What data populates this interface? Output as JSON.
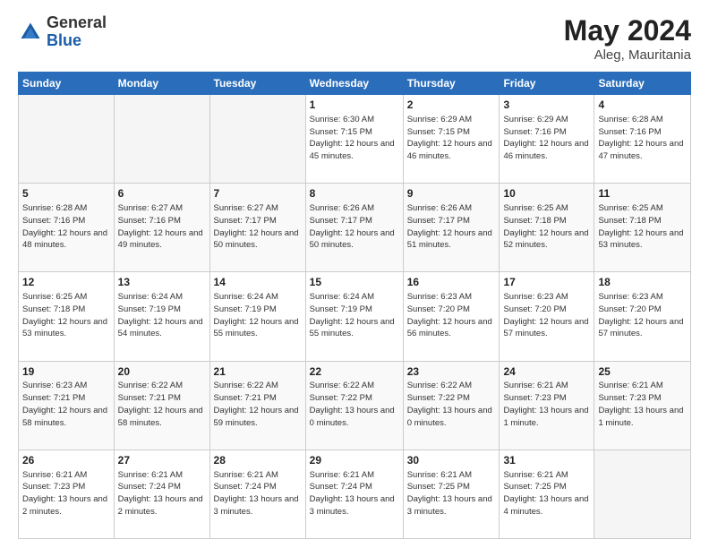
{
  "header": {
    "logo": {
      "line1": "General",
      "line2": "Blue"
    },
    "title": "May 2024",
    "location": "Aleg, Mauritania"
  },
  "weekdays": [
    "Sunday",
    "Monday",
    "Tuesday",
    "Wednesday",
    "Thursday",
    "Friday",
    "Saturday"
  ],
  "weeks": [
    [
      {
        "day": "",
        "info": ""
      },
      {
        "day": "",
        "info": ""
      },
      {
        "day": "",
        "info": ""
      },
      {
        "day": "1",
        "info": "Sunrise: 6:30 AM\nSunset: 7:15 PM\nDaylight: 12 hours\nand 45 minutes."
      },
      {
        "day": "2",
        "info": "Sunrise: 6:29 AM\nSunset: 7:15 PM\nDaylight: 12 hours\nand 46 minutes."
      },
      {
        "day": "3",
        "info": "Sunrise: 6:29 AM\nSunset: 7:16 PM\nDaylight: 12 hours\nand 46 minutes."
      },
      {
        "day": "4",
        "info": "Sunrise: 6:28 AM\nSunset: 7:16 PM\nDaylight: 12 hours\nand 47 minutes."
      }
    ],
    [
      {
        "day": "5",
        "info": "Sunrise: 6:28 AM\nSunset: 7:16 PM\nDaylight: 12 hours\nand 48 minutes."
      },
      {
        "day": "6",
        "info": "Sunrise: 6:27 AM\nSunset: 7:16 PM\nDaylight: 12 hours\nand 49 minutes."
      },
      {
        "day": "7",
        "info": "Sunrise: 6:27 AM\nSunset: 7:17 PM\nDaylight: 12 hours\nand 50 minutes."
      },
      {
        "day": "8",
        "info": "Sunrise: 6:26 AM\nSunset: 7:17 PM\nDaylight: 12 hours\nand 50 minutes."
      },
      {
        "day": "9",
        "info": "Sunrise: 6:26 AM\nSunset: 7:17 PM\nDaylight: 12 hours\nand 51 minutes."
      },
      {
        "day": "10",
        "info": "Sunrise: 6:25 AM\nSunset: 7:18 PM\nDaylight: 12 hours\nand 52 minutes."
      },
      {
        "day": "11",
        "info": "Sunrise: 6:25 AM\nSunset: 7:18 PM\nDaylight: 12 hours\nand 53 minutes."
      }
    ],
    [
      {
        "day": "12",
        "info": "Sunrise: 6:25 AM\nSunset: 7:18 PM\nDaylight: 12 hours\nand 53 minutes."
      },
      {
        "day": "13",
        "info": "Sunrise: 6:24 AM\nSunset: 7:19 PM\nDaylight: 12 hours\nand 54 minutes."
      },
      {
        "day": "14",
        "info": "Sunrise: 6:24 AM\nSunset: 7:19 PM\nDaylight: 12 hours\nand 55 minutes."
      },
      {
        "day": "15",
        "info": "Sunrise: 6:24 AM\nSunset: 7:19 PM\nDaylight: 12 hours\nand 55 minutes."
      },
      {
        "day": "16",
        "info": "Sunrise: 6:23 AM\nSunset: 7:20 PM\nDaylight: 12 hours\nand 56 minutes."
      },
      {
        "day": "17",
        "info": "Sunrise: 6:23 AM\nSunset: 7:20 PM\nDaylight: 12 hours\nand 57 minutes."
      },
      {
        "day": "18",
        "info": "Sunrise: 6:23 AM\nSunset: 7:20 PM\nDaylight: 12 hours\nand 57 minutes."
      }
    ],
    [
      {
        "day": "19",
        "info": "Sunrise: 6:23 AM\nSunset: 7:21 PM\nDaylight: 12 hours\nand 58 minutes."
      },
      {
        "day": "20",
        "info": "Sunrise: 6:22 AM\nSunset: 7:21 PM\nDaylight: 12 hours\nand 58 minutes."
      },
      {
        "day": "21",
        "info": "Sunrise: 6:22 AM\nSunset: 7:21 PM\nDaylight: 12 hours\nand 59 minutes."
      },
      {
        "day": "22",
        "info": "Sunrise: 6:22 AM\nSunset: 7:22 PM\nDaylight: 13 hours\nand 0 minutes."
      },
      {
        "day": "23",
        "info": "Sunrise: 6:22 AM\nSunset: 7:22 PM\nDaylight: 13 hours\nand 0 minutes."
      },
      {
        "day": "24",
        "info": "Sunrise: 6:21 AM\nSunset: 7:23 PM\nDaylight: 13 hours\nand 1 minute."
      },
      {
        "day": "25",
        "info": "Sunrise: 6:21 AM\nSunset: 7:23 PM\nDaylight: 13 hours\nand 1 minute."
      }
    ],
    [
      {
        "day": "26",
        "info": "Sunrise: 6:21 AM\nSunset: 7:23 PM\nDaylight: 13 hours\nand 2 minutes."
      },
      {
        "day": "27",
        "info": "Sunrise: 6:21 AM\nSunset: 7:24 PM\nDaylight: 13 hours\nand 2 minutes."
      },
      {
        "day": "28",
        "info": "Sunrise: 6:21 AM\nSunset: 7:24 PM\nDaylight: 13 hours\nand 3 minutes."
      },
      {
        "day": "29",
        "info": "Sunrise: 6:21 AM\nSunset: 7:24 PM\nDaylight: 13 hours\nand 3 minutes."
      },
      {
        "day": "30",
        "info": "Sunrise: 6:21 AM\nSunset: 7:25 PM\nDaylight: 13 hours\nand 3 minutes."
      },
      {
        "day": "31",
        "info": "Sunrise: 6:21 AM\nSunset: 7:25 PM\nDaylight: 13 hours\nand 4 minutes."
      },
      {
        "day": "",
        "info": ""
      }
    ]
  ]
}
